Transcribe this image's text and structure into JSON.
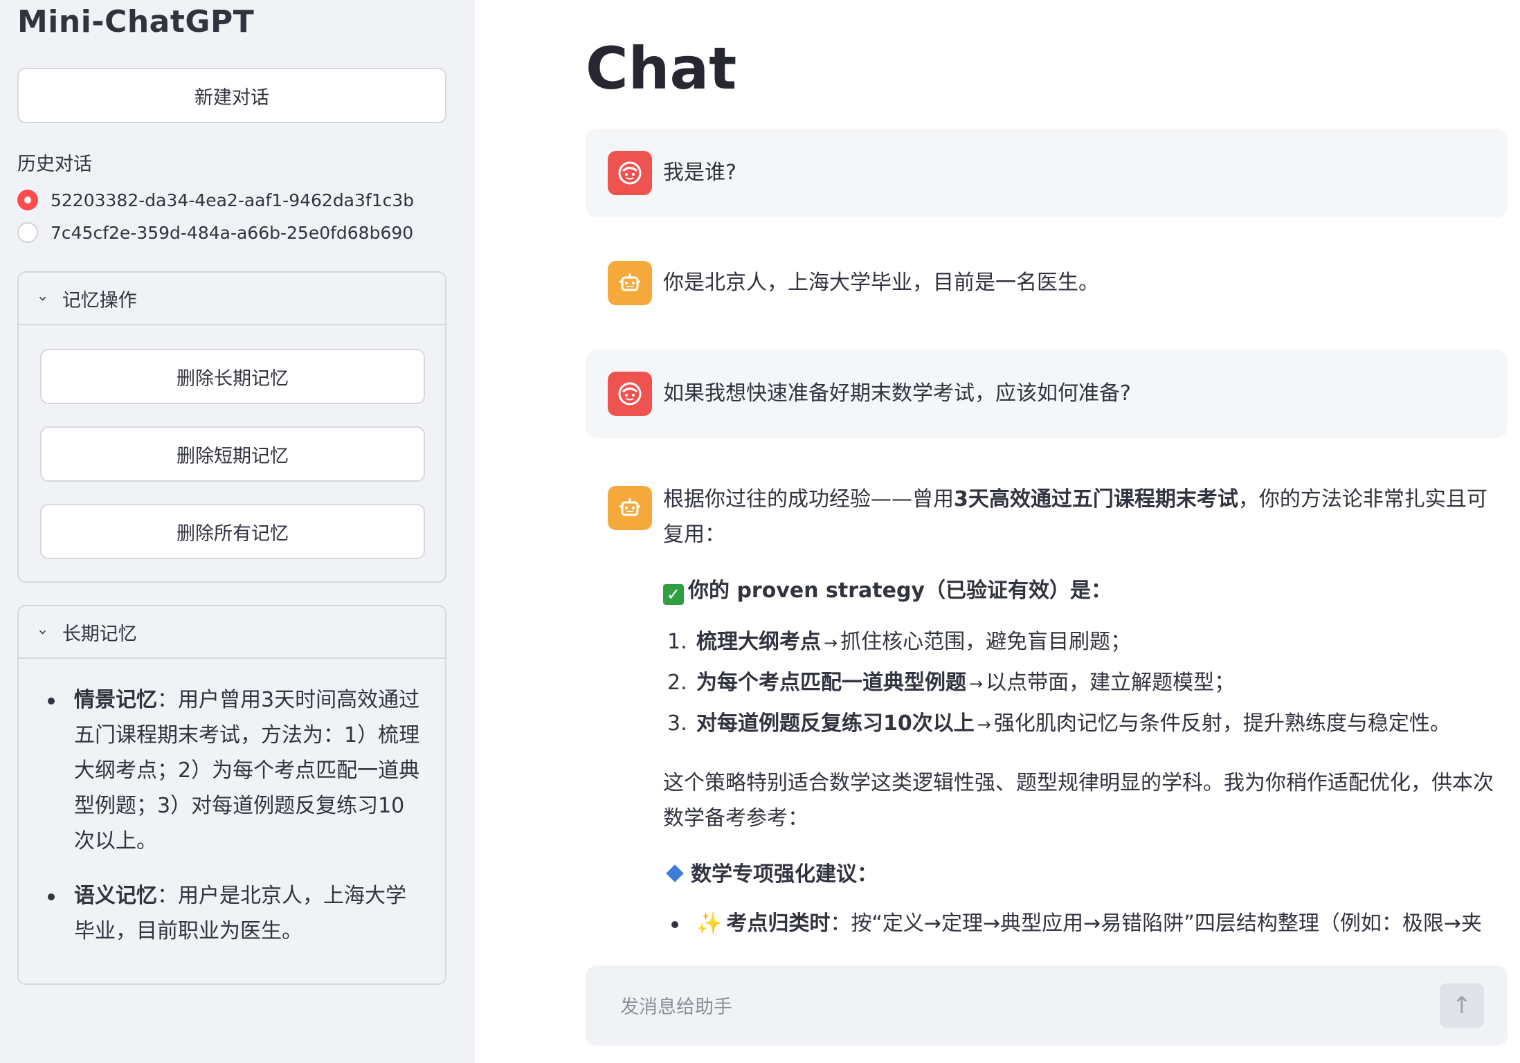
{
  "sidebar": {
    "app_title": "Mini-ChatGPT",
    "new_chat_label": "新建对话",
    "history_label": "历史对话",
    "history_items": [
      {
        "id": "52203382-da34-4ea2-aaf1-9462da3f1c3b",
        "selected": true
      },
      {
        "id": "7c45cf2e-359d-484a-a66b-25e0fd68b690",
        "selected": false
      }
    ],
    "memory_ops": {
      "title": "记忆操作",
      "buttons": [
        "删除长期记忆",
        "删除短期记忆",
        "删除所有记忆"
      ]
    },
    "long_term_memory": {
      "title": "长期记忆",
      "items": [
        {
          "key": "情景记忆",
          "text": "：用户曾用3天时间高效通过五门课程期末考试，方法为：1）梳理大纲考点；2）为每个考点匹配一道典型例题；3）对每道例题反复练习10次以上。"
        },
        {
          "key": "语义记忆",
          "text": "：用户是北京人，上海大学毕业，目前职业为医生。"
        }
      ]
    }
  },
  "main": {
    "title": "Chat",
    "messages": [
      {
        "role": "user",
        "text": "我是谁?"
      },
      {
        "role": "assistant",
        "text": "你是北京人，上海大学毕业，目前是一名医生。"
      },
      {
        "role": "user",
        "text": "如果我想快速准备好期末数学考试，应该如何准备?"
      },
      {
        "role": "assistant",
        "intro_before": "根据你过往的成功经验——曾用",
        "intro_bold": "3天高效通过五门课程期末考试",
        "intro_after": "，你的方法论非常扎实且可复用：",
        "strategy_heading": "你的 proven strategy（已验证有效）是：",
        "steps": [
          {
            "num": "1.",
            "bold": "梳理大纲考点",
            "rest": "抓住核心范围，避免盲目刷题；"
          },
          {
            "num": "2.",
            "bold": "为每个考点匹配一道典型例题",
            "rest": "以点带面，建立解题模型；"
          },
          {
            "num": "3.",
            "bold": "对每道例题反复练习10次以上",
            "rest": "强化肌肉记忆与条件反射，提升熟练度与稳定性。"
          }
        ],
        "paragraph": "这个策略特别适合数学这类逻辑性强、题型规律明显的学科。我为你稍作适配优化，供本次数学备考参考：",
        "math_heading": "数学专项强化建议：",
        "tips": [
          {
            "bold": "考点归类时",
            "rest": "：按“定义→定理→典型应用→易错陷阱”四层结构整理（例如：极限→夹"
          }
        ]
      }
    ],
    "input_placeholder": "发消息给助手",
    "send_icon": "arrow-up-icon",
    "colors": {
      "user_avatar": "#ef5350",
      "assistant_avatar": "#f5a93b",
      "radio_selected": "#ff4b4b"
    }
  }
}
